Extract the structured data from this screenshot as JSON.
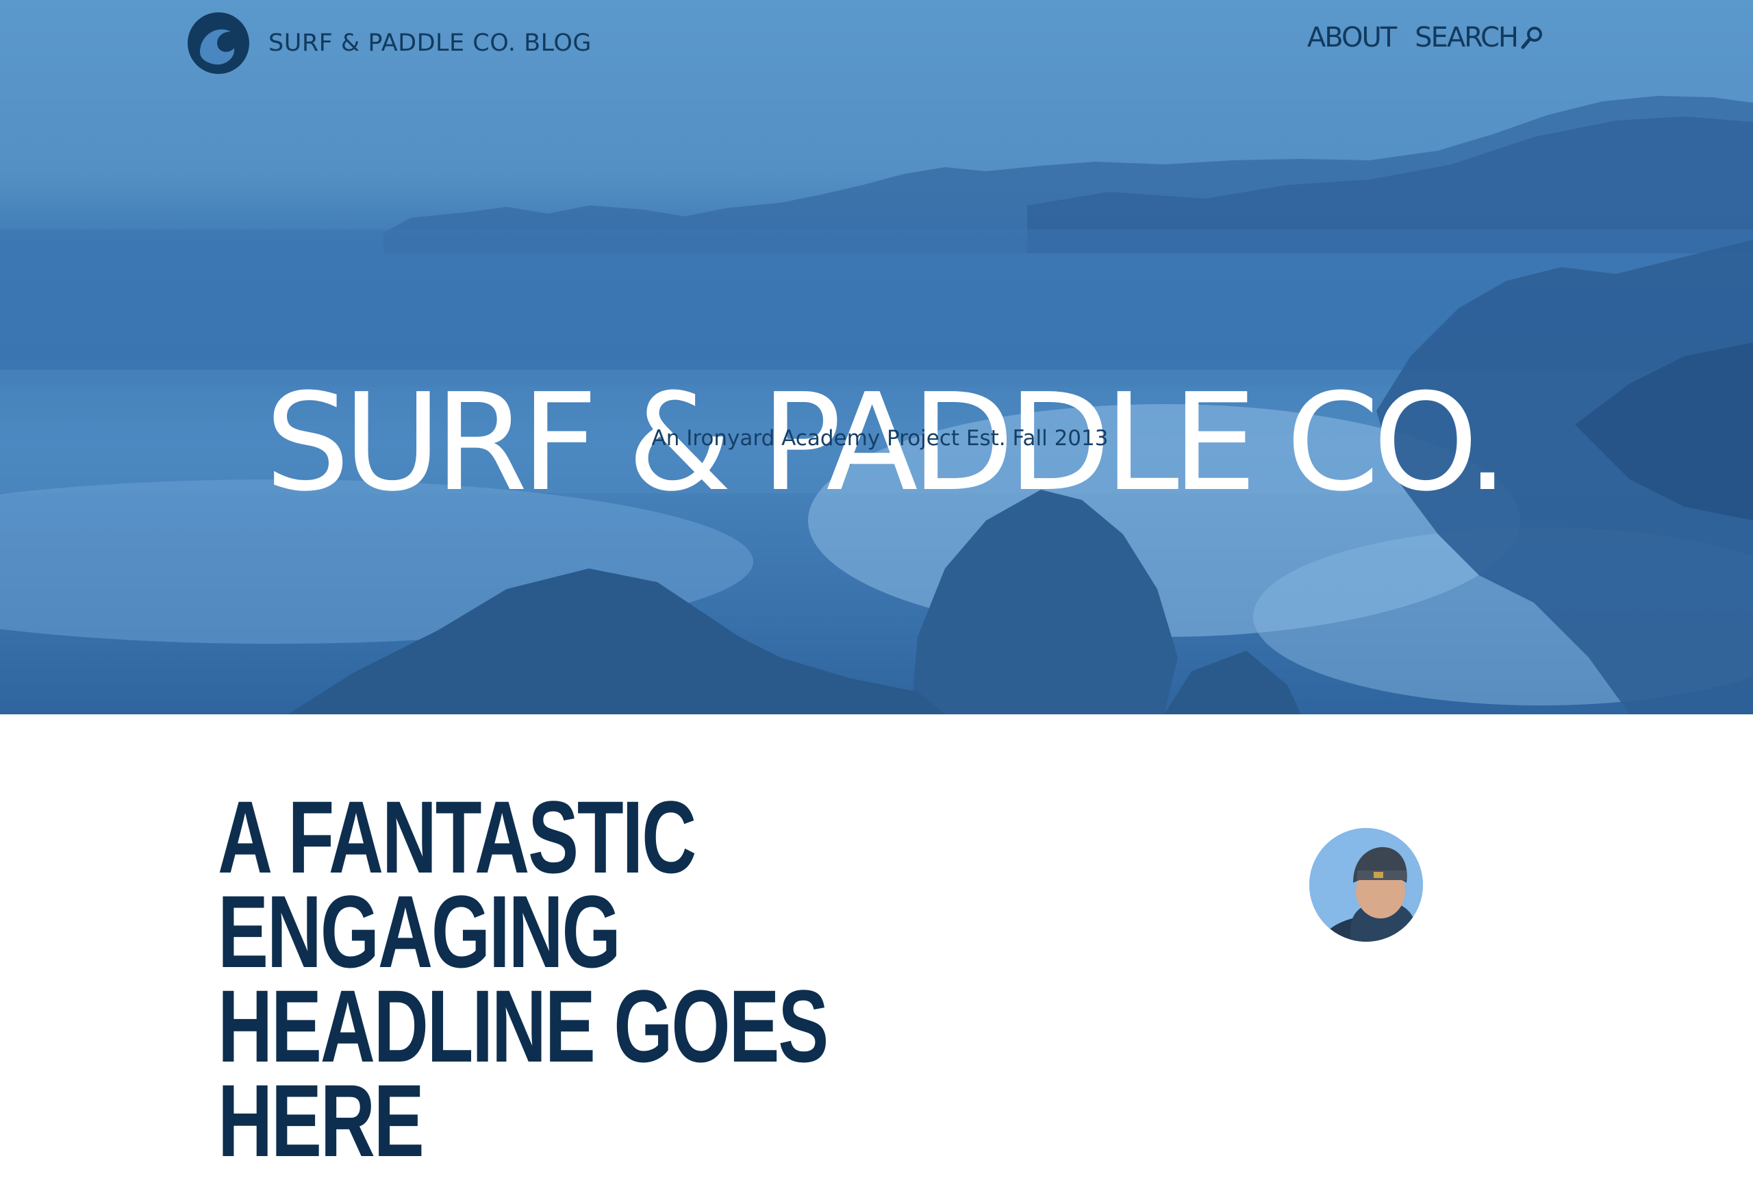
{
  "nav": {
    "brand_name": "SURF & PADDLE CO. BLOG",
    "logo_icon": "wave-logo-icon",
    "about_label": "ABOUT",
    "search_label": "SEARCH",
    "search_icon": "magnifier-icon"
  },
  "hero": {
    "title": "SURF & PADDLE CO.",
    "subtitle": "An Ironyard Academy Project Est. Fall 2013"
  },
  "post": {
    "headline": "A FANTASTIC ENGAGING HEADLINE GOES HERE",
    "author_avatar_icon": "author-avatar"
  },
  "colors": {
    "brand_navy": "#123a5e",
    "hero_blue": "#4a86bf",
    "headline_navy": "#0d2e4e",
    "white": "#ffffff"
  }
}
